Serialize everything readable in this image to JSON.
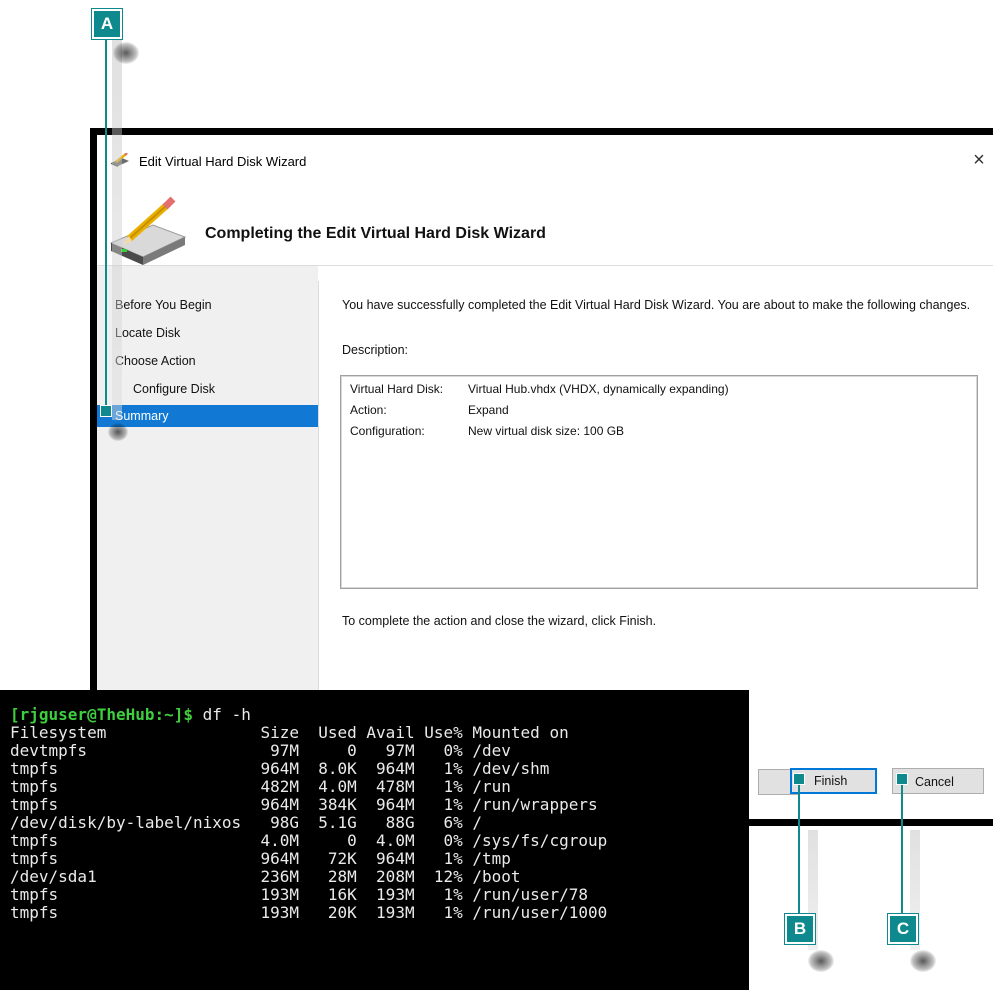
{
  "callouts": {
    "a": "A",
    "b": "B",
    "c": "C"
  },
  "colors": {
    "callout": "#0e8a8f",
    "selection": "#1179d4",
    "prompt": "#3ecf3e"
  },
  "dialog": {
    "window_title": "Edit Virtual Hard Disk Wizard",
    "close_glyph": "×",
    "header_title": "Completing the Edit Virtual Hard Disk Wizard",
    "icons": {
      "title": "disk-pencil-icon",
      "header": "disk-pencil-icon",
      "close": "close-icon"
    },
    "nav": {
      "before_you_begin": "Before You Begin",
      "locate_disk": "Locate Disk",
      "choose_action": "Choose Action",
      "configure_disk": "Configure Disk",
      "summary": "Summary"
    },
    "intro": "You have successfully completed the Edit Virtual Hard Disk Wizard. You are about to make the following changes.",
    "description_label": "Description:",
    "summary": {
      "vhd_key": "Virtual Hard Disk:",
      "vhd_val": "Virtual Hub.vhdx (VHDX, dynamically expanding)",
      "action_key": "Action:",
      "action_val": "Expand",
      "config_key": "Configuration:",
      "config_val": "New virtual disk size: 100 GB"
    },
    "complete_note": "To complete the action and close the wizard, click Finish.",
    "buttons": {
      "finish": "Finish",
      "cancel": "Cancel"
    }
  },
  "terminal": {
    "prompt": "[rjguser@TheHub:~]$",
    "command": " df -h",
    "lines": [
      "Filesystem                Size  Used Avail Use% Mounted on",
      "devtmpfs                   97M     0   97M   0% /dev",
      "tmpfs                     964M  8.0K  964M   1% /dev/shm",
      "tmpfs                     482M  4.0M  478M   1% /run",
      "tmpfs                     964M  384K  964M   1% /run/wrappers",
      "/dev/disk/by-label/nixos   98G  5.1G   88G   6% /",
      "tmpfs                     4.0M     0  4.0M   0% /sys/fs/cgroup",
      "tmpfs                     964M   72K  964M   1% /tmp",
      "/dev/sda1                 236M   28M  208M  12% /boot",
      "tmpfs                     193M   16K  193M   1% /run/user/78",
      "tmpfs                     193M   20K  193M   1% /run/user/1000"
    ]
  }
}
